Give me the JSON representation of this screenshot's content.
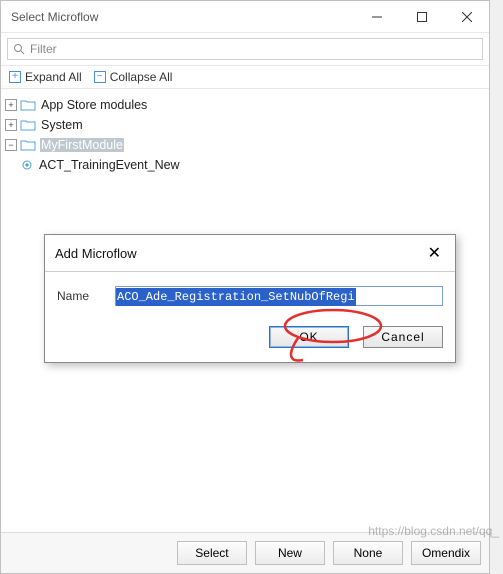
{
  "window": {
    "title": "Select Microflow"
  },
  "filter": {
    "placeholder": "Filter"
  },
  "toolbar": {
    "expand": "Expand All",
    "collapse": "Collapse All"
  },
  "tree": {
    "items": [
      {
        "label": "App Store modules",
        "selected": false
      },
      {
        "label": "System",
        "selected": false
      },
      {
        "label": "MyFirstModule",
        "selected": true
      },
      {
        "label": "ACT_TrainingEvent_New",
        "selected": false
      }
    ]
  },
  "modal": {
    "title": "Add Microflow",
    "name_label": "Name",
    "name_value": "ACO_Ade_Registration_SetNubOfRegi",
    "ok": "OK",
    "cancel": "Cancel"
  },
  "footer": {
    "select": "Select",
    "new": "New",
    "none": "None",
    "last": "Omendix"
  },
  "watermark": "https://blog.csdn.net/qq_"
}
